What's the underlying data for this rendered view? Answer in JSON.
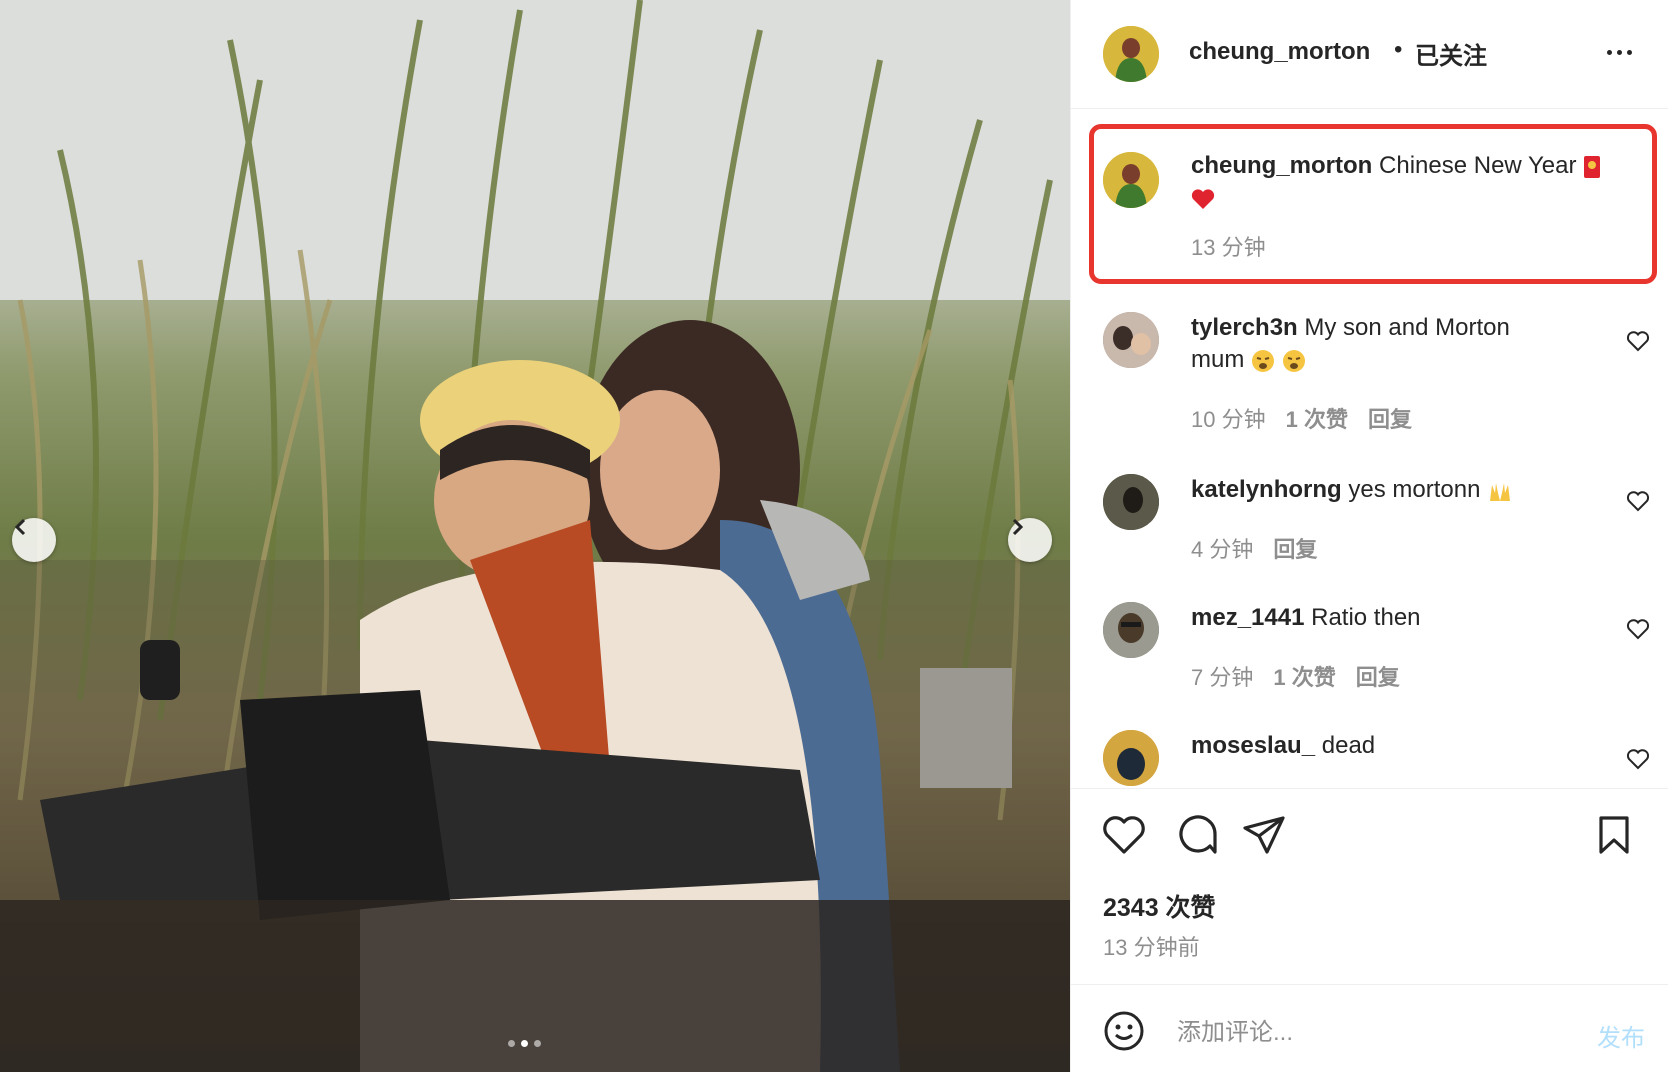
{
  "post_author": {
    "username": "cheung_morton",
    "separator": "•",
    "follow_status": "已关注"
  },
  "caption": {
    "username": "cheung_morton",
    "text": "Chinese New Year",
    "time": "13 分钟"
  },
  "comments": [
    {
      "username": "tylerch3n",
      "text": "My son and Morton",
      "text2": "mum",
      "time": "10 分钟",
      "likes": "1 次赞",
      "reply": "回复"
    },
    {
      "username": "katelynhorng",
      "text": "yes mortonn",
      "time": "4 分钟",
      "reply": "回复"
    },
    {
      "username": "mez_1441",
      "text": "Ratio then",
      "time": "7 分钟",
      "likes": "1 次赞",
      "reply": "回复"
    },
    {
      "username": "moseslau_",
      "text": "dead"
    }
  ],
  "actions": {
    "likes_count": "2343 次赞",
    "posted_time": "13 分钟前"
  },
  "comment_box": {
    "placeholder": "添加评论...",
    "post_label": "发布"
  },
  "colors": {
    "highlight_border": "#e8362e",
    "post_button": "#b2dffc",
    "meta_text": "#8e8e8e"
  },
  "carousel": {
    "slides": 3,
    "active": 2
  }
}
